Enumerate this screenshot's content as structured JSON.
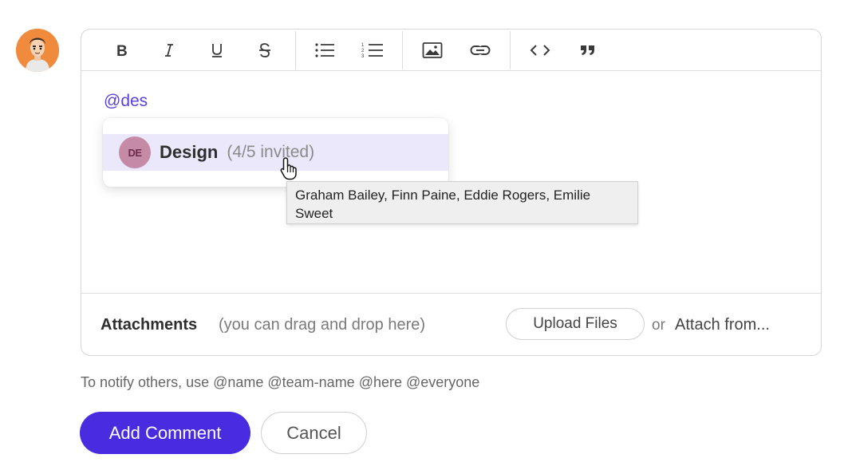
{
  "user": {
    "avatar_icon": "user-avatar-cartoon",
    "avatar_color": "#f08a3c"
  },
  "toolbar": {
    "buttons": [
      {
        "name": "bold",
        "icon": "bold-icon"
      },
      {
        "name": "italic",
        "icon": "italic-icon"
      },
      {
        "name": "underline",
        "icon": "underline-icon"
      },
      {
        "name": "strikethrough",
        "icon": "strikethrough-icon"
      },
      {
        "name": "bulleted-list",
        "icon": "bulleted-list-icon"
      },
      {
        "name": "numbered-list",
        "icon": "numbered-list-icon"
      },
      {
        "name": "image",
        "icon": "image-icon"
      },
      {
        "name": "link",
        "icon": "link-icon"
      },
      {
        "name": "code",
        "icon": "code-icon"
      },
      {
        "name": "quote",
        "icon": "quote-icon"
      }
    ]
  },
  "editor": {
    "content": "@des",
    "mention_color": "#5b42d8"
  },
  "mention_popup": {
    "items": [
      {
        "badge": "DE",
        "name": "Design",
        "count": "(4/5 invited)",
        "badge_color": "#c58aa6",
        "highlight_color": "#ece8fb"
      }
    ]
  },
  "tooltip": {
    "text": "Graham Bailey, Finn Paine, Eddie Rogers, Emilie Sweet"
  },
  "attachments": {
    "title": "Attachments",
    "hint": "(you can drag and drop here)",
    "upload_label": "Upload Files",
    "or_label": "or",
    "attach_from_label": "Attach from..."
  },
  "notify_hint": "To notify others, use @name @team-name @here @everyone",
  "actions": {
    "add_label": "Add Comment",
    "cancel_label": "Cancel",
    "accent_color": "#4a2ce0"
  }
}
